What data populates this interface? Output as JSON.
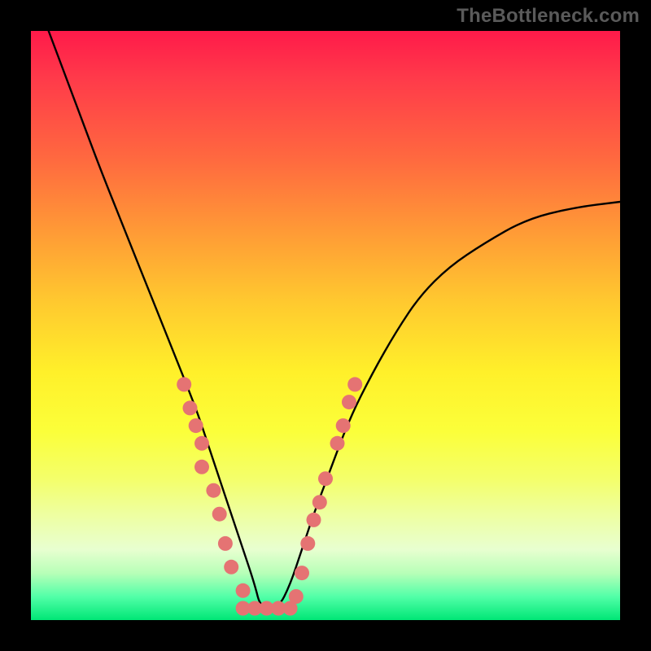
{
  "watermark_text": "TheBottleneck.com",
  "colors": {
    "curve": "#000000",
    "marker_fill": "#e57373",
    "marker_stroke": "#cc6666",
    "gradient_top": "#ff1a4a",
    "gradient_bottom": "#00e676",
    "page_bg": "#000000"
  },
  "chart_data": {
    "type": "line",
    "title": "",
    "xlabel": "",
    "ylabel": "",
    "xlim": [
      0,
      100
    ],
    "ylim": [
      0,
      100
    ],
    "grid": false,
    "legend": false,
    "note": "x/y are percentage coordinates within the plot area; y=0 is bottom (green), y=100 is top (red). Curve has a V-shaped minimum near x≈39 with right arm bowing down.",
    "series": [
      {
        "name": "bottleneck-curve",
        "x": [
          3,
          6,
          9,
          12,
          16,
          20,
          24,
          28,
          30,
          32,
          34,
          36,
          38,
          39,
          42,
          44,
          46,
          48,
          51,
          54,
          58,
          62,
          66,
          71,
          77,
          84,
          92,
          100
        ],
        "y": [
          100,
          92,
          84,
          76,
          66,
          56,
          46,
          36,
          30,
          24,
          18,
          12,
          6,
          2,
          2,
          6,
          12,
          18,
          26,
          34,
          42,
          49,
          55,
          60,
          64,
          68,
          70,
          71
        ]
      }
    ],
    "markers": {
      "name": "highlight-dots",
      "note": "salmon dots clustered along both arms near the valley and a flat row at the very bottom",
      "points": [
        {
          "x": 26,
          "y": 40
        },
        {
          "x": 27,
          "y": 36
        },
        {
          "x": 28,
          "y": 33
        },
        {
          "x": 29,
          "y": 30
        },
        {
          "x": 29,
          "y": 26
        },
        {
          "x": 31,
          "y": 22
        },
        {
          "x": 32,
          "y": 18
        },
        {
          "x": 33,
          "y": 13
        },
        {
          "x": 34,
          "y": 9
        },
        {
          "x": 36,
          "y": 5
        },
        {
          "x": 36,
          "y": 2
        },
        {
          "x": 38,
          "y": 2
        },
        {
          "x": 40,
          "y": 2
        },
        {
          "x": 42,
          "y": 2
        },
        {
          "x": 44,
          "y": 2
        },
        {
          "x": 45,
          "y": 4
        },
        {
          "x": 46,
          "y": 8
        },
        {
          "x": 47,
          "y": 13
        },
        {
          "x": 48,
          "y": 17
        },
        {
          "x": 49,
          "y": 20
        },
        {
          "x": 50,
          "y": 24
        },
        {
          "x": 52,
          "y": 30
        },
        {
          "x": 53,
          "y": 33
        },
        {
          "x": 54,
          "y": 37
        },
        {
          "x": 55,
          "y": 40
        }
      ],
      "radius": 9
    }
  }
}
